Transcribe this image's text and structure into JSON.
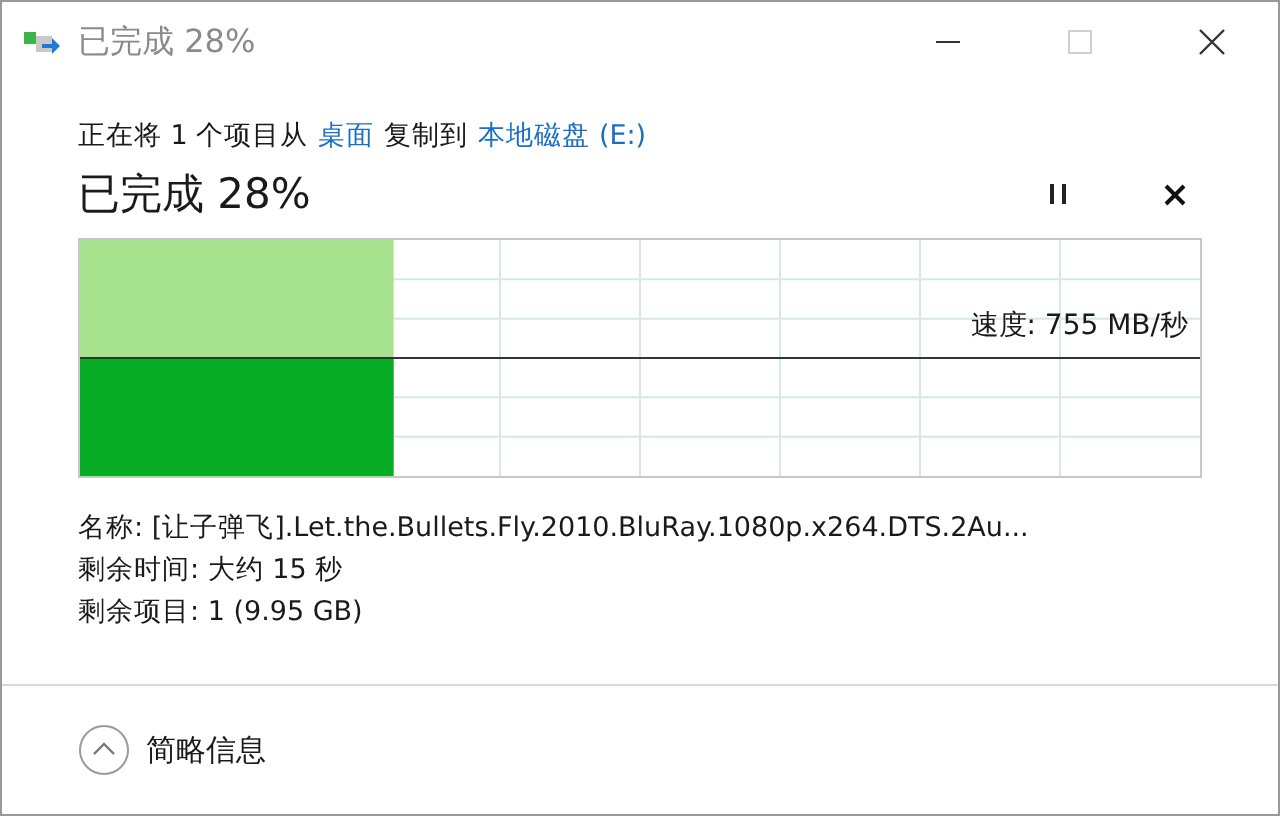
{
  "window": {
    "title": "已完成 28%",
    "maximize_disabled": true
  },
  "message": [
    {
      "kind": "text",
      "text": "正在将 1 个项目从"
    },
    {
      "kind": "link",
      "text": "桌面"
    },
    {
      "kind": "text",
      "text": "复制到"
    },
    {
      "kind": "link",
      "text": "本地磁盘 (E:)"
    }
  ],
  "progress": {
    "title": "已完成 28%",
    "level": 0.28
  },
  "speed": {
    "label": "速度: 755 MB/秒"
  },
  "details": [
    "名称: [让子弹飞].Let.the.Bullets.Fly.2010.BluRay.1080p.x264.DTS.2Au...",
    "剩余时间: 大约 15 秒",
    "剩余项目: 1 (9.95 GB)"
  ],
  "footer": {
    "label": "简略信息",
    "expanded": true
  }
}
